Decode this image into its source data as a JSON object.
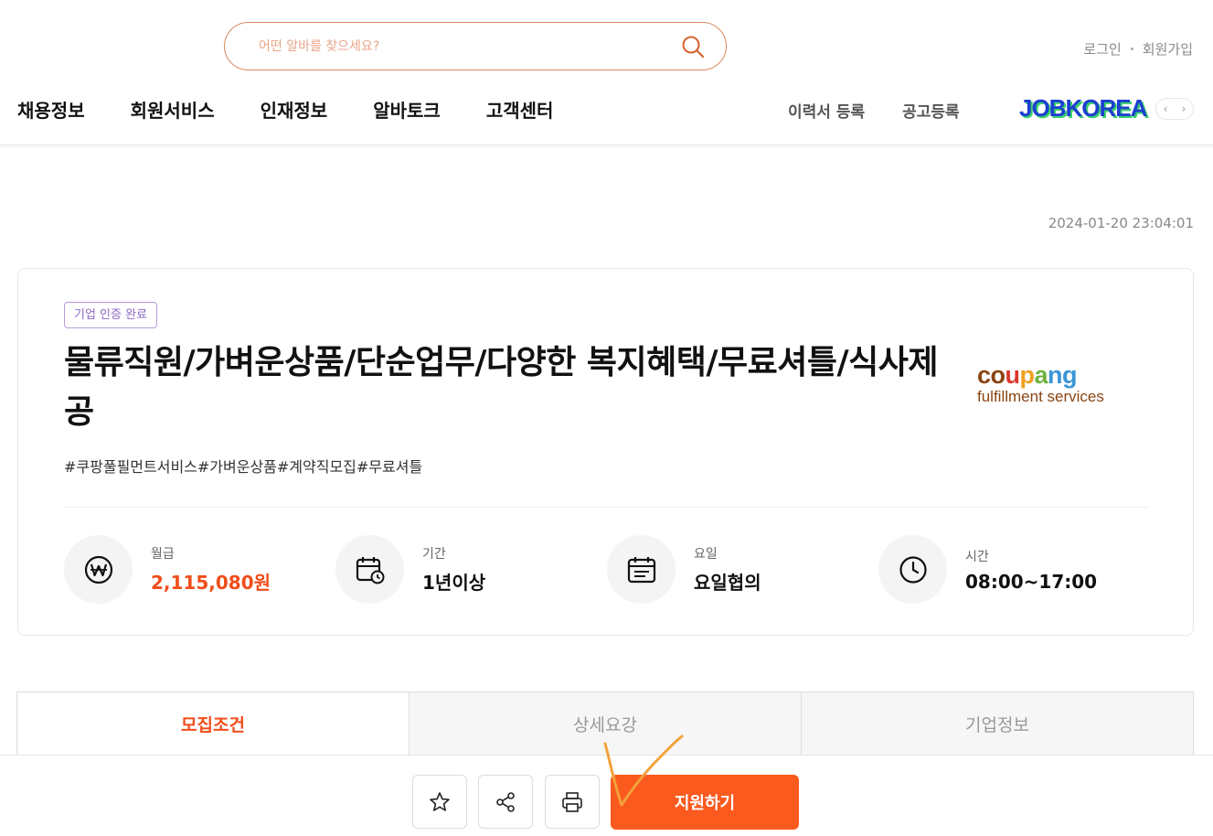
{
  "header": {
    "search_placeholder": "어떤 알바를 찾으세요?",
    "auth": {
      "login": "로그인",
      "signup": "회원가입"
    },
    "nav": [
      "채용정보",
      "회원서비스",
      "인재정보",
      "알바토크",
      "고객센터"
    ],
    "nav_right": [
      "이력서 등록",
      "공고등록"
    ],
    "partner_logo": "JOBKOREA"
  },
  "posted_at": "2024-01-20 23:04:01",
  "job": {
    "badge": "기업 인증 완료",
    "title": "물류직원/가벼운상품/단순업무/다양한 복지혜택/무료셔틀/식사제공",
    "tags": "#쿠팡풀필먼트서비스#가벼운상품#계약직모집#무료셔틀",
    "company_logo": {
      "brand": "coupang",
      "sub": "fulfillment services"
    },
    "info": [
      {
        "label": "월급",
        "value": "2,115,080원",
        "icon": "won-icon"
      },
      {
        "label": "기간",
        "value": "1년이상",
        "icon": "calendar-clock-icon"
      },
      {
        "label": "요일",
        "value": "요일협의",
        "icon": "calendar-icon"
      },
      {
        "label": "시간",
        "value": "08:00~17:00",
        "icon": "clock-icon"
      }
    ]
  },
  "tabs": [
    "모집조건",
    "상세요강",
    "기업정보"
  ],
  "bottom": {
    "apply_label": "지원하기",
    "icons": [
      "star-icon",
      "share-icon",
      "print-icon"
    ]
  },
  "colors": {
    "accent": "#fb5a1e",
    "salary": "#f04d1a",
    "badge": "#8b68c5"
  }
}
